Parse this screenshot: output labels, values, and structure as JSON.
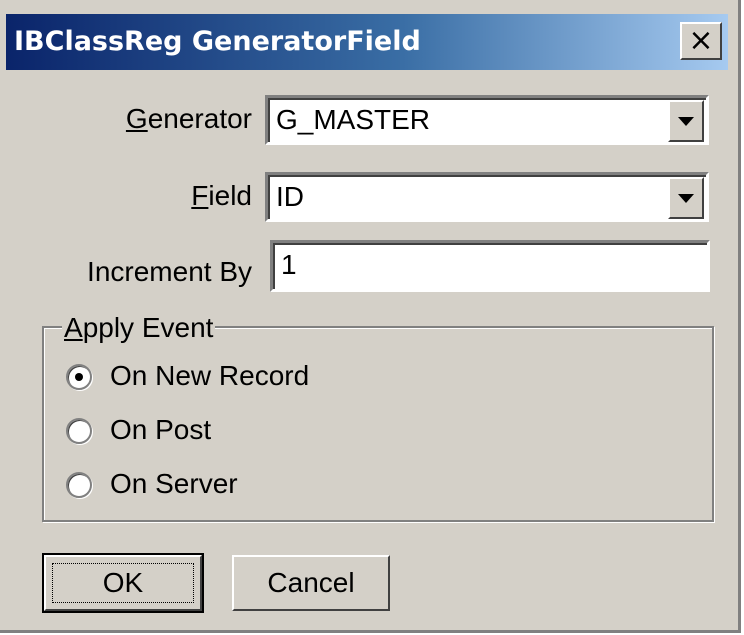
{
  "window": {
    "title": "IBClassReg GeneratorField",
    "close_glyph": "×"
  },
  "form": {
    "generator": {
      "label_mnemonic": "G",
      "label_rest": "enerator",
      "value": "G_MASTER"
    },
    "field": {
      "label_mnemonic": "F",
      "label_rest": "ield",
      "value": "ID"
    },
    "increment": {
      "label": "Increment By",
      "value": "1"
    }
  },
  "apply_event": {
    "legend_mnemonic": "A",
    "legend_rest": "pply Event",
    "options": [
      {
        "label": "On New Record",
        "selected": true
      },
      {
        "label": "On Post",
        "selected": false
      },
      {
        "label": "On Server",
        "selected": false
      }
    ]
  },
  "buttons": {
    "ok": "OK",
    "cancel": "Cancel"
  },
  "colors": {
    "titlebar_start": "#0a246a",
    "titlebar_end": "#a6caf0",
    "face": "#d4d0c8"
  }
}
